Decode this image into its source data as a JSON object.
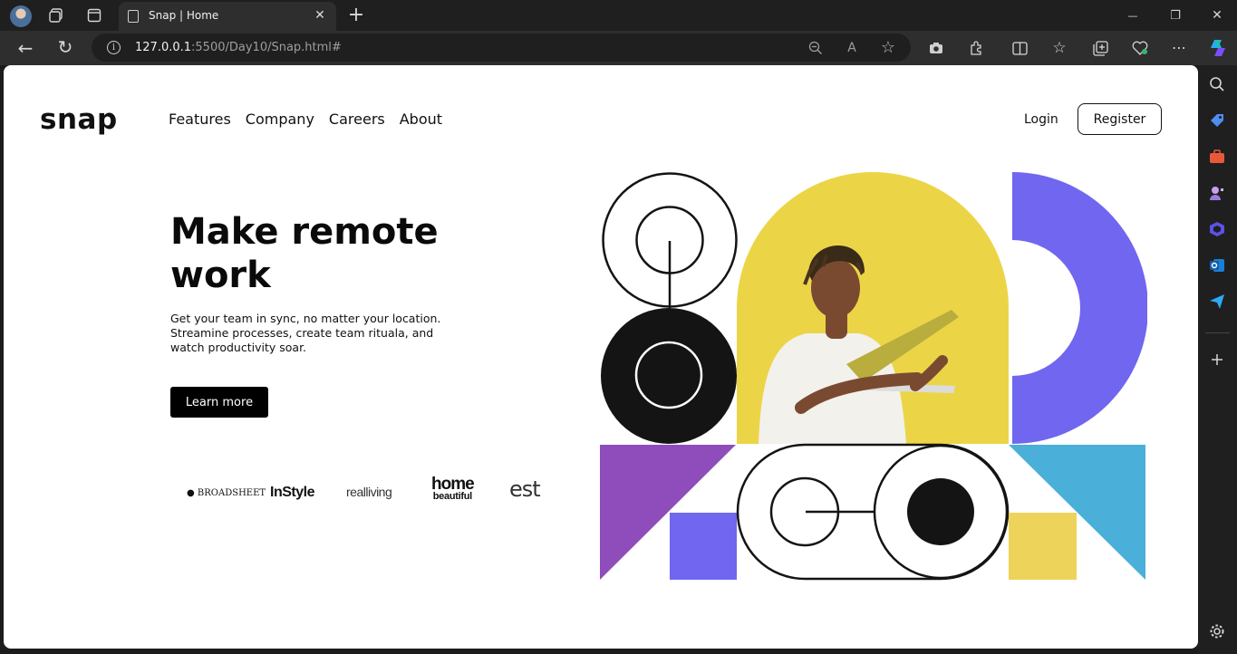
{
  "browser": {
    "tab_title": "Snap | Home",
    "tab_close": "✕",
    "new_tab": "+",
    "url_host": "127.0.0.1",
    "url_path": ":5500/Day10/Snap.html#",
    "url_info": "i",
    "window": {
      "minimize": "—",
      "restore": "❐",
      "close": "✕"
    },
    "nav": {
      "back": "←",
      "refresh": "↻"
    },
    "toolbar": {
      "more": "⋯"
    }
  },
  "site": {
    "logo": "snap",
    "nav": [
      "Features",
      "Company",
      "Careers",
      "About"
    ],
    "login": "Login",
    "register": "Register"
  },
  "hero": {
    "title": "Make remote work",
    "description": "Get your team in sync, no matter your location. Streamine processes, create team rituala, and watch productivity soar.",
    "cta": "Learn more"
  },
  "brands": {
    "broadsheet": "● BROADSHEET",
    "instyle": "InStyle",
    "realliving": "realliving",
    "home_top": "home",
    "home_bottom": "beautiful",
    "est": "est"
  },
  "colors": {
    "yellow": "#ebd547",
    "purple": "#7066f0",
    "violet": "#8e4dba",
    "sky": "#4aafd9",
    "mustard": "#edd35a",
    "ink": "#141414"
  }
}
